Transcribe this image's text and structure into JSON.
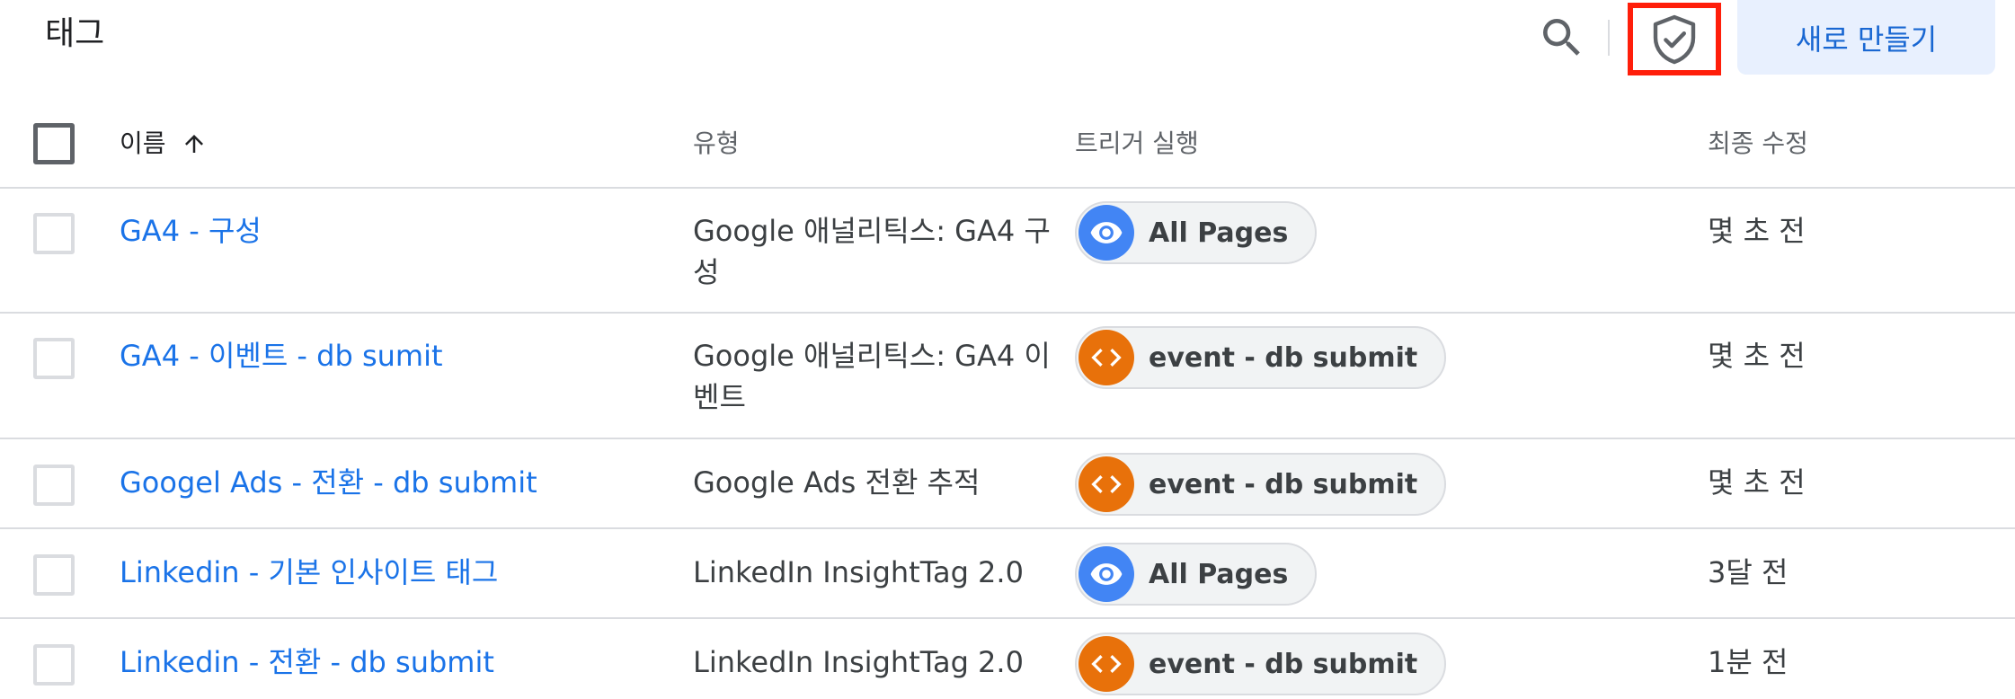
{
  "header": {
    "title": "태그",
    "search_icon": "search-icon",
    "consent_icon": "shield-check-icon",
    "new_button_label": "새로 만들기"
  },
  "table": {
    "columns": {
      "name": "이름",
      "type": "유형",
      "trigger": "트리거 실행",
      "modified": "최종 수정"
    },
    "sort": "ascending",
    "rows": [
      {
        "name": "GA4 - 구성",
        "type": "Google 애널리틱스: GA4 구성",
        "trigger": {
          "label": "All Pages",
          "icon": "eye-icon",
          "color": "#4285f4"
        },
        "modified": "몇 초 전"
      },
      {
        "name": "GA4 - 이벤트 - db sumit",
        "type": "Google 애널리틱스: GA4 이벤트",
        "trigger": {
          "label": "event - db submit",
          "icon": "code-icon",
          "color": "#e8710a"
        },
        "modified": "몇 초 전"
      },
      {
        "name": "Googel Ads - 전환 - db submit",
        "type": "Google Ads 전환 추적",
        "trigger": {
          "label": "event - db submit",
          "icon": "code-icon",
          "color": "#e8710a"
        },
        "modified": "몇 초 전"
      },
      {
        "name": "Linkedin - 기본 인사이트 태그",
        "type": "LinkedIn InsightTag 2.0",
        "trigger": {
          "label": "All Pages",
          "icon": "eye-icon",
          "color": "#4285f4"
        },
        "modified": "3달 전"
      },
      {
        "name": "Linkedin - 전환 - db submit",
        "type": "LinkedIn InsightTag 2.0",
        "trigger": {
          "label": "event - db submit",
          "icon": "code-icon",
          "color": "#e8710a"
        },
        "modified": "1분 전"
      }
    ]
  },
  "colors": {
    "link": "#1a73e8",
    "accent_button_bg": "#e8f0fe",
    "highlight_border": "#ff1e0a"
  }
}
